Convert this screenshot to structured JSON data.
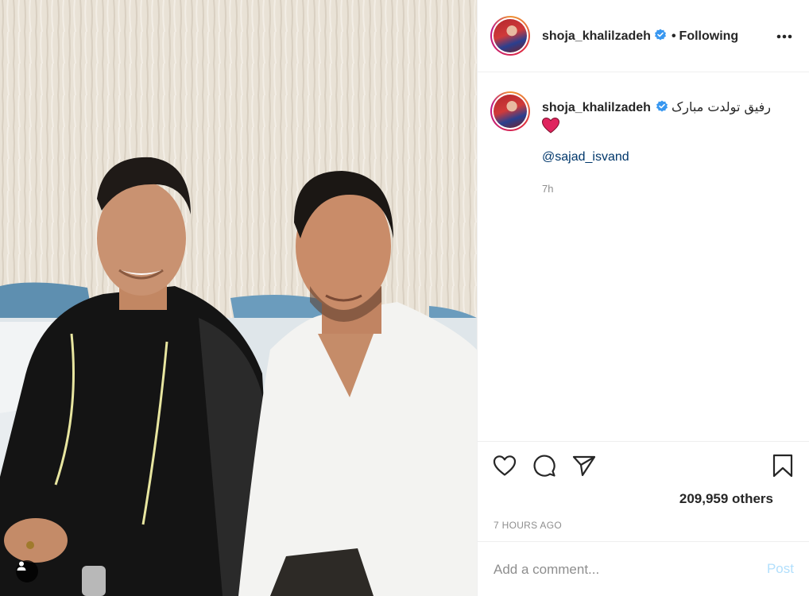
{
  "post": {
    "username": "shoja_khalilzadeh",
    "follow_separator": "•",
    "follow_status": "Following",
    "caption_text": "رفیق تولدت مبارک",
    "caption_emoji": "red-heart-emoji",
    "mention": "@sajad_isvand",
    "caption_time": "7h",
    "likes_text": "209,959 others",
    "posted_time": "7 HOURS AGO"
  },
  "comment": {
    "placeholder": "Add a comment...",
    "post_label": "Post"
  },
  "icons": {
    "verified": "verified-badge-icon",
    "more": "more-options-icon",
    "like": "heart-icon",
    "comment": "comment-icon",
    "share": "paper-plane-icon",
    "save": "bookmark-icon",
    "tags": "user-tag-icon"
  },
  "colors": {
    "verified_blue": "#3897f0",
    "link": "#00376b",
    "muted": "#8e8e8e",
    "post_disabled": "#b2dffc",
    "heart_red": "#e0245e"
  }
}
